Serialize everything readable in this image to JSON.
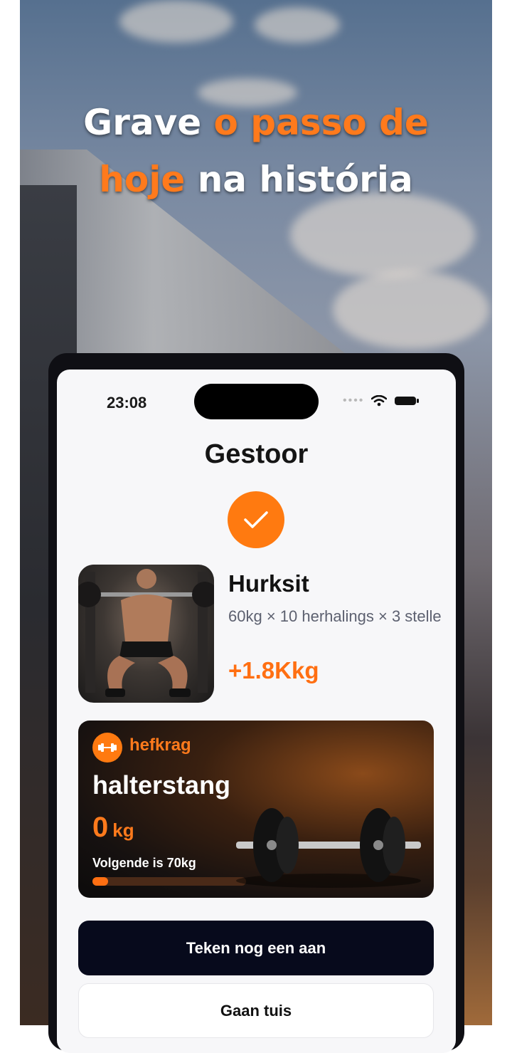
{
  "promo": {
    "headline_1": "Grave ",
    "headline_accent_1": "o passo de",
    "headline_accent_2": "hoje",
    "headline_2": " na história"
  },
  "status_bar": {
    "time": "23:08",
    "icons": [
      "signal-icon",
      "wifi-icon",
      "battery-icon"
    ]
  },
  "page": {
    "title": "Gestoor"
  },
  "exercise": {
    "name": "Hurksit",
    "detail": "60kg × 10 herhalings × 3 stelle",
    "gain": "+1.8Kkg"
  },
  "lift_card": {
    "brand": "hefkrag",
    "name": "halterstang",
    "value": "0",
    "unit": "kg",
    "next": "Volgende is 70kg",
    "progress_fraction": 0.1
  },
  "buttons": {
    "primary": "Teken nog een aan",
    "secondary": "Gaan tuis"
  },
  "colors": {
    "accent": "#ff7a1c",
    "primary_button": "#070a1c",
    "screen_bg": "#f7f7f9"
  }
}
